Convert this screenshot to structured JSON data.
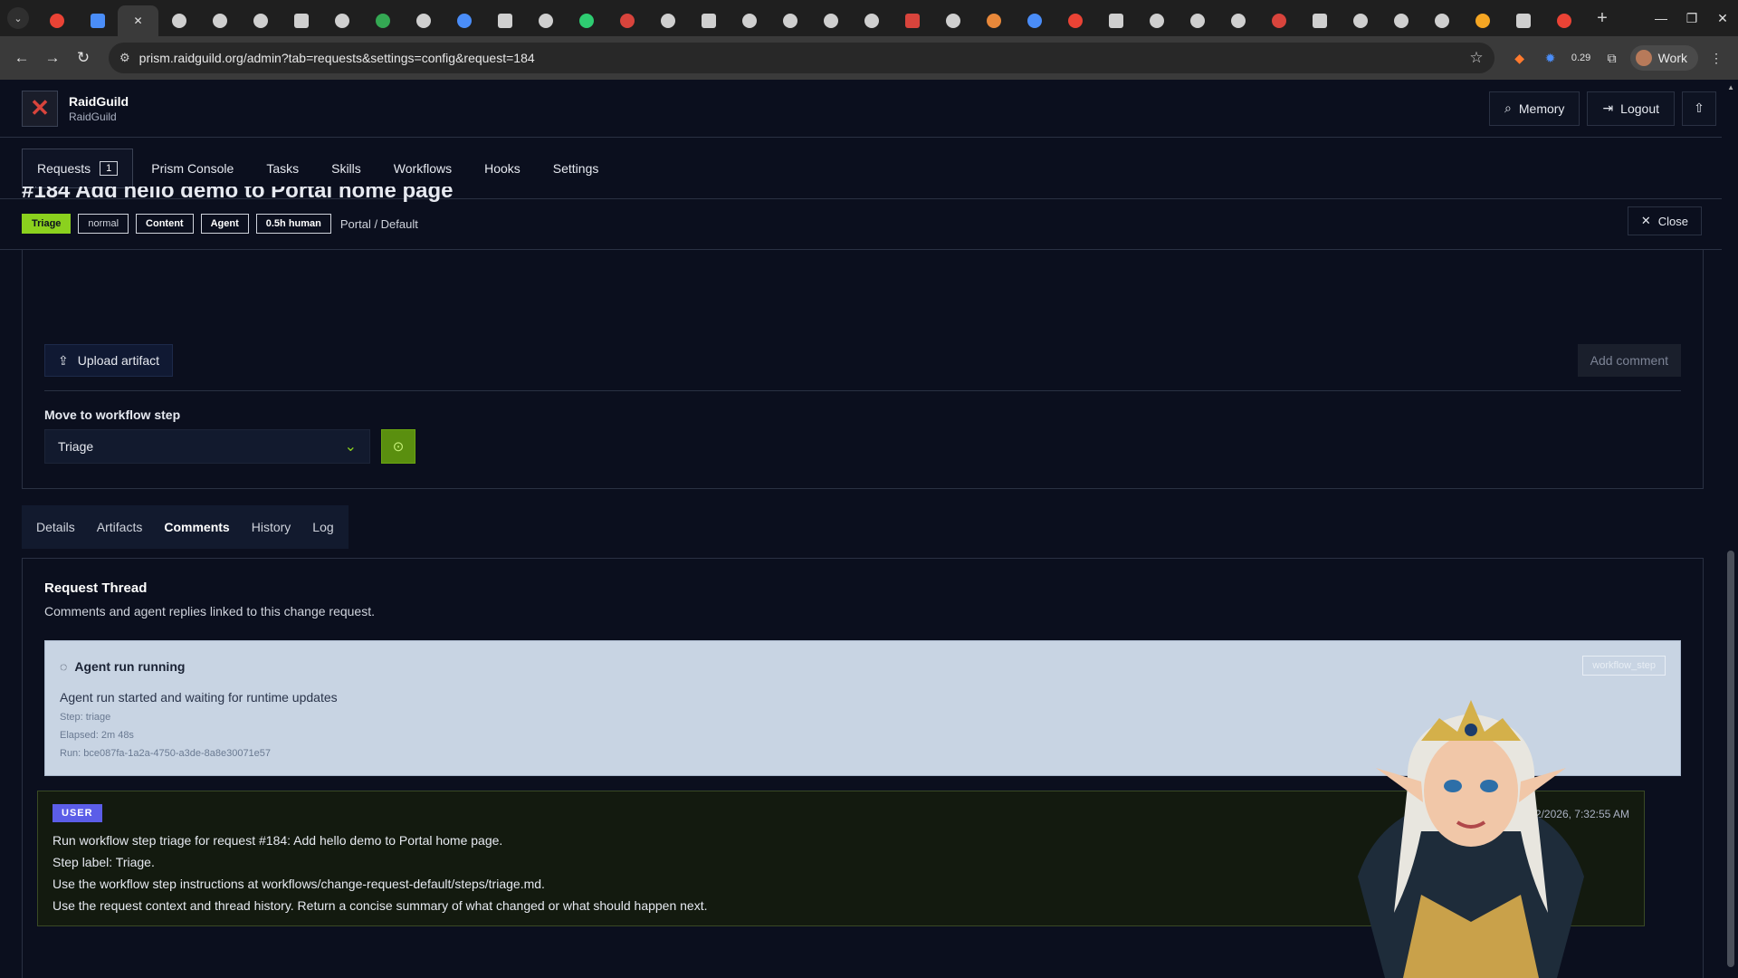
{
  "browser": {
    "url": "prism.raidguild.org/admin?tab=requests&settings=config&request=184",
    "profile_label": "Work",
    "extension_badge": "0.29",
    "tab_count": 38
  },
  "app": {
    "brand_name": "RaidGuild",
    "brand_sub": "RaidGuild",
    "header_buttons": {
      "memory": "Memory",
      "logout": "Logout"
    },
    "nav": [
      {
        "label": "Requests",
        "count": "1"
      },
      {
        "label": "Prism Console"
      },
      {
        "label": "Tasks"
      },
      {
        "label": "Skills"
      },
      {
        "label": "Workflows"
      },
      {
        "label": "Hooks"
      },
      {
        "label": "Settings"
      }
    ]
  },
  "request": {
    "title": "#184 Add hello demo to Portal home page",
    "badges": [
      "Triage",
      "normal",
      "Content",
      "Agent",
      "0.5h human"
    ],
    "crumb": "Portal / Default",
    "close_label": "Close",
    "upload_label": "Upload artifact",
    "add_comment_label": "Add comment",
    "move_label": "Move to workflow step",
    "move_value": "Triage"
  },
  "detail_tabs": [
    "Details",
    "Artifacts",
    "Comments",
    "History",
    "Log"
  ],
  "thread": {
    "title": "Request Thread",
    "subtitle": "Comments and agent replies linked to this change request.",
    "run": {
      "status": "Agent run running",
      "tag": "workflow_step",
      "message": "Agent run started and waiting for runtime updates",
      "step": "Step: triage",
      "elapsed": "Elapsed: 2m 48s",
      "run_id": "Run: bce087fa-1a2a-4750-a3de-8a8e30071e57"
    },
    "user_msg": {
      "role": "USER",
      "timestamp": "3/12/2026, 7:32:55 AM",
      "lines": [
        "Run workflow step triage for request #184: Add hello demo to Portal home page.",
        "Step label: Triage.",
        "Use the workflow step instructions at workflows/change-request-default/steps/triage.md.",
        "Use the request context and thread history. Return a concise summary of what changed or what should happen next."
      ]
    }
  },
  "colors": {
    "accent_green": "#8bd11e",
    "user_badge": "#5b5de8",
    "bg": "#0b0f1e"
  }
}
